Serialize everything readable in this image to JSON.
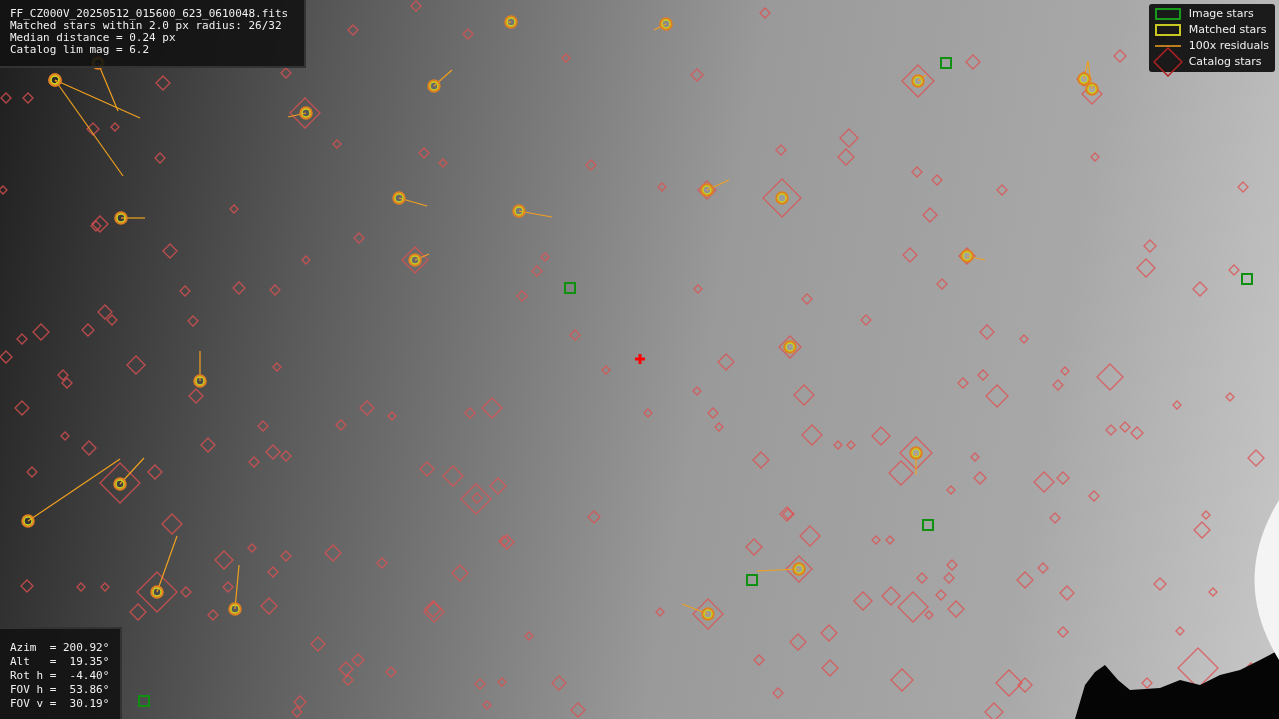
{
  "info_box": {
    "lines": [
      "FF_CZ000V_20250512_015600_623_0610048.fits",
      "Matched stars within 2.0 px radius: 26/32",
      "Median distance = 0.24 px",
      "Catalog lim mag = 6.2"
    ]
  },
  "legend": [
    {
      "kind": "image",
      "label": "Image stars"
    },
    {
      "kind": "matched",
      "label": "Matched stars"
    },
    {
      "kind": "residual",
      "label": "100x residuals"
    },
    {
      "kind": "catalog",
      "label": "Catalog stars"
    }
  ],
  "pointing_box": {
    "lines": [
      "Azim  = 200.92°",
      "Alt   =  19.35°",
      "Rot h =  -4.40°",
      "FOV h =  53.86°",
      "FOV v =  30.19°"
    ]
  }
}
